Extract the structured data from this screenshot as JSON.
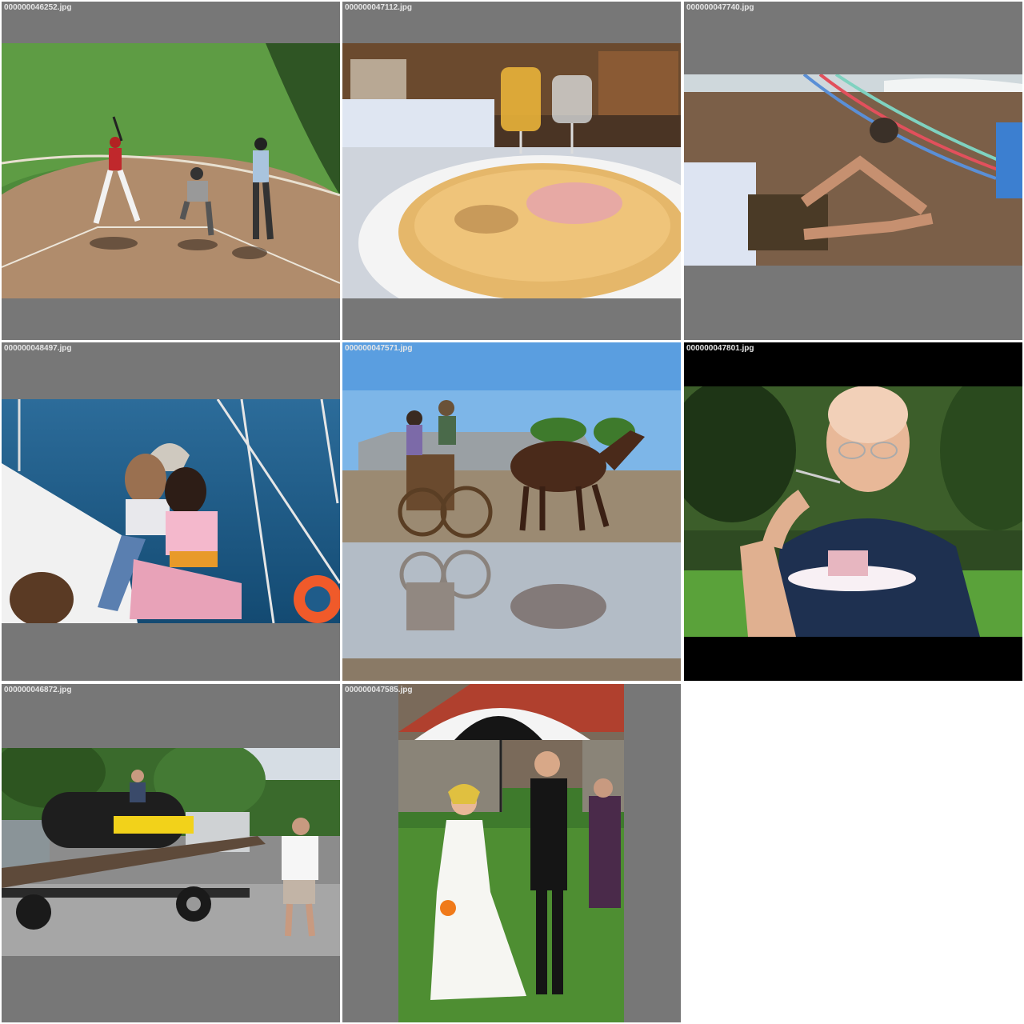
{
  "gallery": {
    "tiles": [
      {
        "filename": "000000046252.jpg"
      },
      {
        "filename": "000000047112.jpg"
      },
      {
        "filename": "000000047740.jpg"
      },
      {
        "filename": "000000048497.jpg"
      },
      {
        "filename": "000000047571.jpg"
      },
      {
        "filename": "000000047801.jpg"
      },
      {
        "filename": "000000046872.jpg"
      },
      {
        "filename": "000000047585.jpg"
      }
    ]
  },
  "colors": {
    "tile_background": "#777777",
    "tile_background_dark": "#000000",
    "label_text": "#e6e6e6",
    "page_background": "#ffffff"
  }
}
